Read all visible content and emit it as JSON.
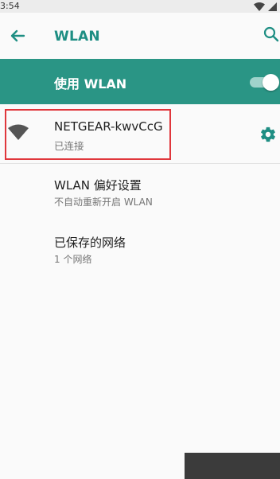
{
  "status_bar": {
    "time": "3:54"
  },
  "appbar": {
    "title": "WLAN"
  },
  "master_switch": {
    "label": "使用 WLAN",
    "on": true
  },
  "connected_network": {
    "name": "NETGEAR-kwvCcG",
    "status": "已连接"
  },
  "preferences": [
    {
      "title": "WLAN 偏好设置",
      "subtitle": "不自动重新开启 WLAN"
    },
    {
      "title": "已保存的网络",
      "subtitle": "1 个网络"
    }
  ],
  "colors": {
    "accent": "#2a9585",
    "title_teal": "#1e8e83",
    "highlight": "#e0373c"
  }
}
